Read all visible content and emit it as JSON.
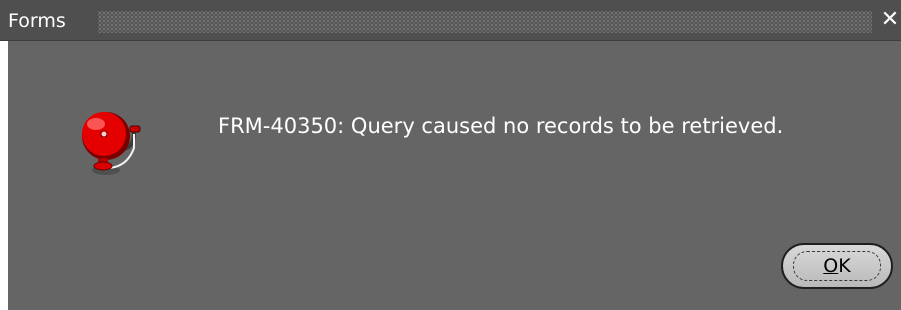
{
  "window": {
    "title": "Forms",
    "close_glyph": "✕"
  },
  "dialog": {
    "message": "FRM-40350: Query caused no records to be retrieved.",
    "icon": "alarm-bell-icon"
  },
  "buttons": {
    "ok_mnemonic": "O",
    "ok_rest": "K"
  },
  "colors": {
    "dialog_background": "#656565",
    "titlebar_background": "#4f4f4f",
    "text": "#ffffff",
    "bell_red": "#e40000",
    "button_face": "#cfcfcf"
  }
}
